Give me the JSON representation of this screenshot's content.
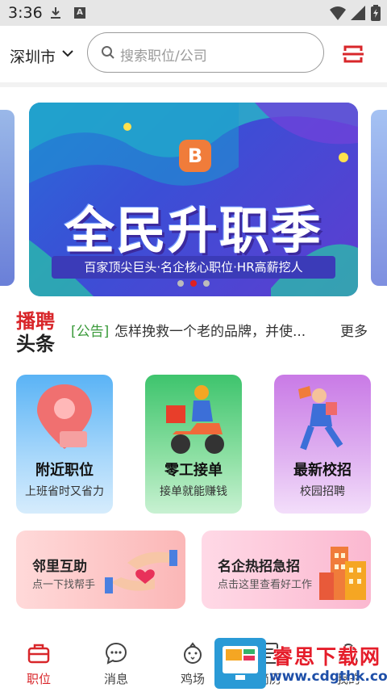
{
  "status_bar": {
    "time": "3:36"
  },
  "header": {
    "city": "深圳市",
    "search_placeholder": "搜索职位/公司"
  },
  "banner": {
    "logo_letter": "B",
    "title": "全民升职季",
    "subtitle": "百家顶尖巨头·名企核心职位·HR高薪挖人",
    "dot_count": 3,
    "active_dot": 1
  },
  "news": {
    "brand_line1": "播聘",
    "brand_line2": "头条",
    "tag": "[公告]",
    "text": "怎样挽救一个老的品牌，并使...",
    "more": "更多"
  },
  "feature_cards": [
    {
      "title": "附近职位",
      "subtitle": "上班省时又省力"
    },
    {
      "title": "零工接单",
      "subtitle": "接单就能赚钱"
    },
    {
      "title": "最新校招",
      "subtitle": "校园招聘"
    }
  ],
  "promo_cards": [
    {
      "title": "邻里互助",
      "subtitle": "点一下找帮手"
    },
    {
      "title": "名企热招急招",
      "subtitle": "点击这里查看好工作"
    }
  ],
  "tabs": [
    {
      "label": "职位",
      "icon": "briefcase-icon",
      "active": true
    },
    {
      "label": "消息",
      "icon": "chat-icon",
      "active": false
    },
    {
      "label": "鸡场",
      "icon": "chick-icon",
      "active": false
    },
    {
      "label": "简历",
      "icon": "resume-icon",
      "active": false
    },
    {
      "label": "我的",
      "icon": "profile-icon",
      "active": false
    }
  ],
  "watermark": {
    "name": "睿思下载网",
    "url": "www.cdgthk.com"
  },
  "colors": {
    "accent": "#d8262a",
    "news_tag": "#3a9a3a"
  }
}
